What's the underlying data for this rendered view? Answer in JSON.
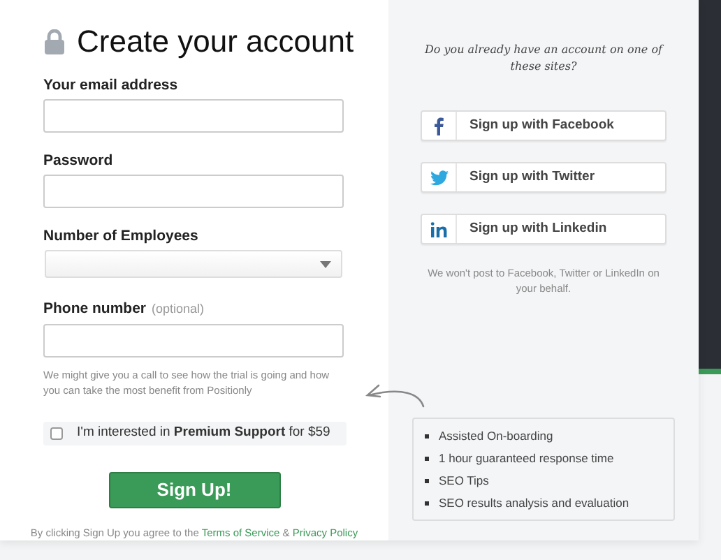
{
  "title": "Create your account",
  "fields": [
    {
      "label": "Your email address",
      "kind": "text"
    },
    {
      "label": "Password",
      "kind": "text"
    },
    {
      "label": "Number of Employees",
      "kind": "select"
    },
    {
      "label": "Phone number",
      "note": "(optional)",
      "kind": "text"
    }
  ],
  "phone_hint": "We might give you a call to see how the trial is going and how you can take the most benefit from Positionly",
  "premium": {
    "text": "I'm interested in **Premium Support** for $59",
    "checked": false
  },
  "signup_button": "Sign Up!",
  "agreement": {
    "text": "By clicking Sign Up you agree to the",
    "terms": "Terms of Service",
    "amp": "&",
    "privacy": "Privacy Policy"
  },
  "social": {
    "question": "Do you already have an account on one of these sites?",
    "buttons": [
      {
        "kind": "facebook",
        "label": "Sign up with Facebook"
      },
      {
        "kind": "twitter",
        "label": "Sign up with Twitter"
      },
      {
        "kind": "linkedin",
        "label": "Sign up with Linkedin"
      }
    ],
    "note": "We won't post to Facebook, Twitter or LinkedIn on your behalf."
  },
  "premium_features": [
    "Assisted On-boarding",
    "1 hour guaranteed response time",
    "SEO Tips",
    "SEO results analysis and evaluation"
  ]
}
